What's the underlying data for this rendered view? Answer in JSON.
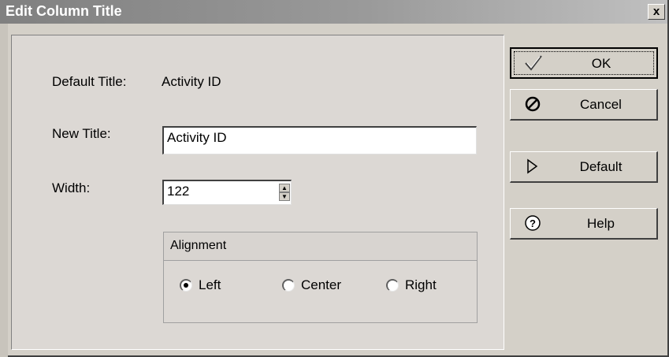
{
  "window": {
    "title": "Edit Column Title",
    "close_label": "x"
  },
  "form": {
    "default_title_label": "Default Title:",
    "default_title_value": "Activity ID",
    "new_title_label": "New Title:",
    "new_title_value": "Activity ID",
    "width_label": "Width:",
    "width_value": "122"
  },
  "alignment": {
    "title": "Alignment",
    "options": [
      {
        "label": "Left",
        "selected": true
      },
      {
        "label": "Center",
        "selected": false
      },
      {
        "label": "Right",
        "selected": false
      }
    ]
  },
  "buttons": {
    "ok": {
      "label": "OK",
      "icon": "checkmark-icon"
    },
    "cancel": {
      "label": "Cancel",
      "icon": "cancel-icon"
    },
    "default": {
      "label": "Default",
      "icon": "triangle-right-icon"
    },
    "help": {
      "label": "Help",
      "icon": "help-icon"
    }
  }
}
